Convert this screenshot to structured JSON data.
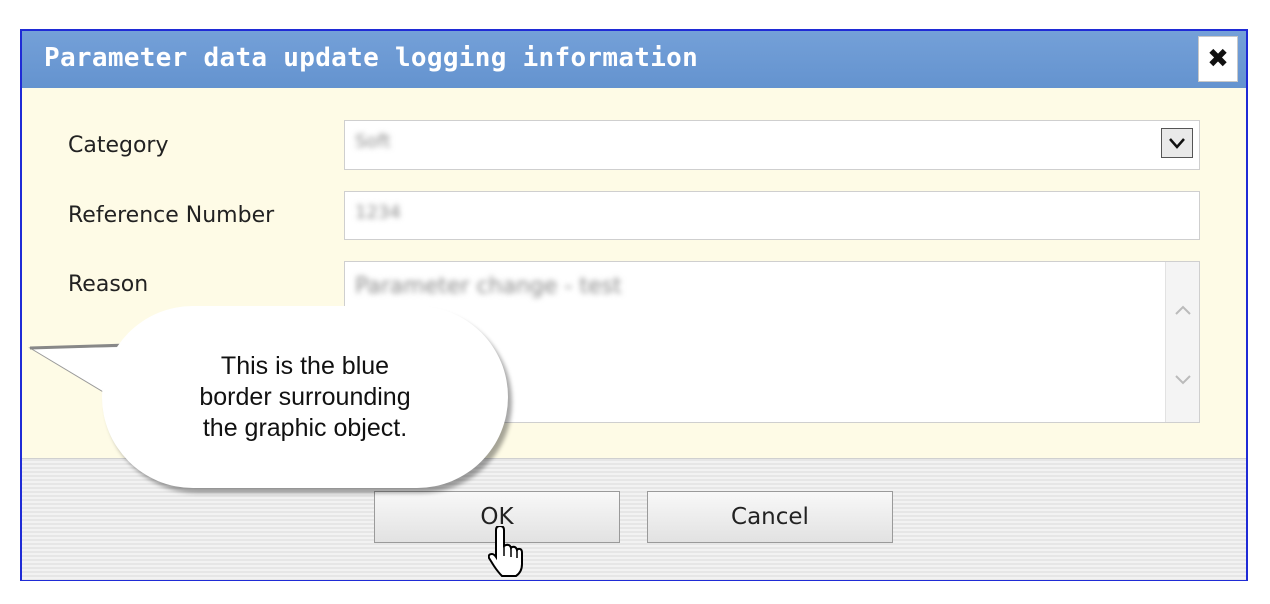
{
  "dialog": {
    "title": "Parameter data update logging information",
    "close_icon": "close-icon",
    "border_color": "#1f2bd6",
    "titlebar_color": "#6a97d2",
    "body_color": "#fefbe6"
  },
  "form": {
    "category": {
      "label": "Category",
      "value": "Soft"
    },
    "reference_number": {
      "label": "Reference Number",
      "value": "1234"
    },
    "reason": {
      "label": "Reason",
      "value": "Parameter change - test"
    }
  },
  "buttons": {
    "ok": "OK",
    "cancel": "Cancel"
  },
  "callout": {
    "line1": "This is the blue",
    "line2": "border surrounding",
    "line3": "the graphic object."
  },
  "cursor_icon": "hand-pointer-icon"
}
